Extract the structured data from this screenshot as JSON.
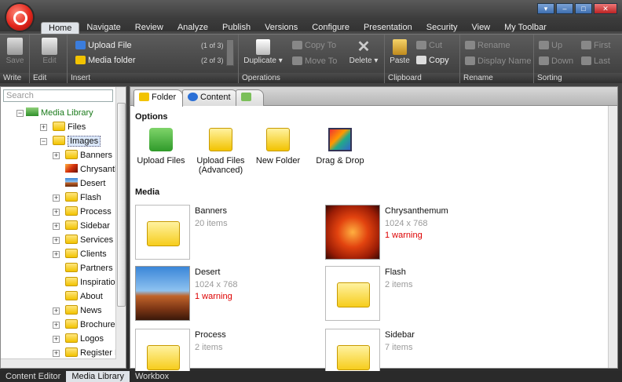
{
  "menu_tabs": [
    "Home",
    "Navigate",
    "Review",
    "Analyze",
    "Publish",
    "Versions",
    "Configure",
    "Presentation",
    "Security",
    "View",
    "My Toolbar"
  ],
  "active_tab": "Home",
  "ribbon": {
    "write": {
      "label": "Write",
      "save": "Save"
    },
    "edit": {
      "label": "Edit",
      "edit": "Edit"
    },
    "insert": {
      "label": "Insert",
      "upload_file": "Upload File",
      "upload_file_count": "(1 of 3)",
      "media_folder": "Media folder",
      "media_folder_count": "(2 of 3)"
    },
    "operations": {
      "label": "Operations",
      "duplicate": "Duplicate",
      "copy_to": "Copy To",
      "move_to": "Move To",
      "delete": "Delete"
    },
    "clipboard": {
      "label": "Clipboard",
      "paste": "Paste",
      "cut": "Cut",
      "copy": "Copy"
    },
    "rename": {
      "label": "Rename",
      "rename": "Rename",
      "display_name": "Display Name"
    },
    "sorting": {
      "label": "Sorting",
      "up": "Up",
      "down": "Down",
      "first": "First",
      "last": "Last"
    }
  },
  "search": {
    "placeholder": "Search"
  },
  "tree": {
    "root": "Media Library",
    "items": [
      {
        "label": "Files",
        "level": 1,
        "expander": "+"
      },
      {
        "label": "Images",
        "level": 1,
        "expander": "−"
      },
      {
        "label": "Banners",
        "level": 2,
        "expander": "+"
      },
      {
        "label": "Chrysanth",
        "level": 2,
        "expander": ""
      },
      {
        "label": "Desert",
        "level": 2,
        "expander": ""
      },
      {
        "label": "Flash",
        "level": 2,
        "expander": "+"
      },
      {
        "label": "Process",
        "level": 2,
        "expander": "+"
      },
      {
        "label": "Sidebar",
        "level": 2,
        "expander": "+"
      },
      {
        "label": "Services",
        "level": 2,
        "expander": "+"
      },
      {
        "label": "Clients",
        "level": 2,
        "expander": "+"
      },
      {
        "label": "Partners",
        "level": 2,
        "expander": ""
      },
      {
        "label": "Inspiration",
        "level": 2,
        "expander": ""
      },
      {
        "label": "About",
        "level": 2,
        "expander": ""
      },
      {
        "label": "News",
        "level": 2,
        "expander": "+"
      },
      {
        "label": "Brochures",
        "level": 2,
        "expander": "+"
      },
      {
        "label": "Logos",
        "level": 2,
        "expander": "+"
      },
      {
        "label": "Register F",
        "level": 2,
        "expander": "+"
      }
    ]
  },
  "panel_tabs": [
    "Folder",
    "Content"
  ],
  "options_heading": "Options",
  "options": [
    "Upload Files",
    "Upload Files (Advanced)",
    "New Folder",
    "Drag & Drop"
  ],
  "media_heading": "Media",
  "media": [
    {
      "name": "Banners",
      "meta": "20 items",
      "warning": ""
    },
    {
      "name": "Chrysanthemum",
      "meta": "1024 x 768",
      "warning": "1 warning"
    },
    {
      "name": "Desert",
      "meta": "1024 x 768",
      "warning": "1 warning"
    },
    {
      "name": "Flash",
      "meta": "2 items",
      "warning": ""
    },
    {
      "name": "Process",
      "meta": "2 items",
      "warning": ""
    },
    {
      "name": "Sidebar",
      "meta": "7 items",
      "warning": ""
    }
  ],
  "bottom_tabs": [
    "Content Editor",
    "Media Library",
    "Workbox"
  ],
  "active_bottom_tab": "Media Library"
}
